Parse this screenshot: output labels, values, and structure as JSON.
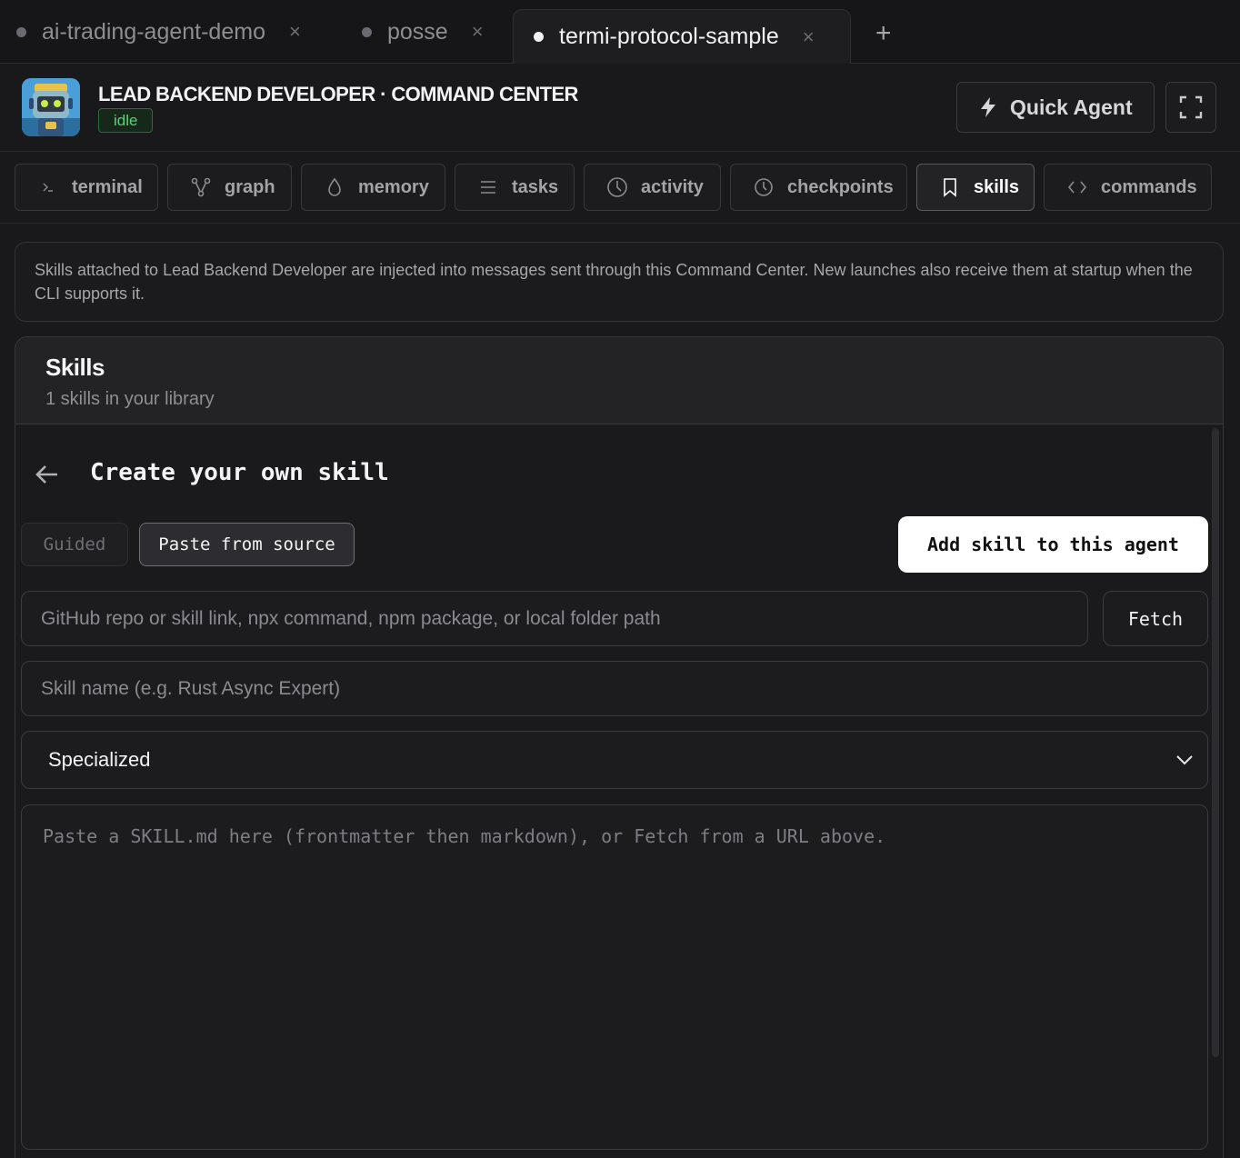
{
  "tabs": [
    {
      "label": "ai-trading-agent-demo",
      "active": false
    },
    {
      "label": "posse",
      "active": false
    },
    {
      "label": "termi-protocol-sample",
      "active": true
    }
  ],
  "tab_close_glyph": "×",
  "tab_add_glyph": "+",
  "header": {
    "title": "LEAD BACKEND DEVELOPER · COMMAND CENTER",
    "status": "idle",
    "quick_agent_label": "Quick Agent"
  },
  "nav": [
    {
      "label": "terminal",
      "icon": "terminal-icon"
    },
    {
      "label": "graph",
      "icon": "graph-icon"
    },
    {
      "label": "memory",
      "icon": "memory-icon"
    },
    {
      "label": "tasks",
      "icon": "tasks-icon"
    },
    {
      "label": "activity",
      "icon": "activity-icon"
    },
    {
      "label": "checkpoints",
      "icon": "checkpoints-icon"
    },
    {
      "label": "skills",
      "icon": "bookmark-icon",
      "active": true
    },
    {
      "label": "commands",
      "icon": "code-icon"
    }
  ],
  "info_text": "Skills attached to Lead Backend Developer are injected into messages sent through this Command Center. New launches also receive them at startup when the CLI supports it.",
  "skills": {
    "title": "Skills",
    "subtitle": "1 skills in your library",
    "create_title": "Create your own skill",
    "mode_guided": "Guided",
    "mode_paste": "Paste from source",
    "active_mode": "Paste from source",
    "add_button": "Add skill to this agent",
    "source_placeholder": "GitHub repo or skill link, npx command, npm package, or local folder path",
    "fetch_button": "Fetch",
    "name_placeholder": "Skill name (e.g. Rust Async Expert)",
    "category_selected": "Specialized",
    "content_placeholder": "Paste a SKILL.md here (frontmatter then markdown), or Fetch from a URL above."
  },
  "colors": {
    "background": "#19191c",
    "status_green": "#5fd07a",
    "primary_button": "#ffffff"
  }
}
